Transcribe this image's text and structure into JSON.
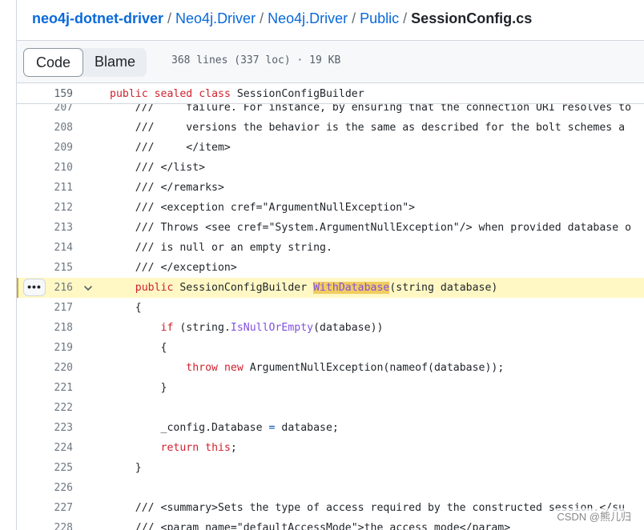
{
  "breadcrumb": {
    "repo": "neo4j-dotnet-driver",
    "sep": "/",
    "parts": [
      "Neo4j.Driver",
      "Neo4j.Driver",
      "Public"
    ],
    "file": "SessionConfig.cs"
  },
  "toolbar": {
    "code_label": "Code",
    "blame_label": "Blame",
    "file_info": "368 lines (337 loc) · 19 KB"
  },
  "sticky": {
    "line": "159",
    "tokens": [
      "public",
      "sealed",
      "class",
      "SessionConfigBuilder"
    ]
  },
  "lines": [
    {
      "n": "207",
      "text": "    ///     failure. For instance, by ensuring that the connection URI resolves to"
    },
    {
      "n": "208",
      "text": "    ///     versions the behavior is the same as described for the bolt schemes a"
    },
    {
      "n": "209",
      "text": "    ///     </item>"
    },
    {
      "n": "210",
      "text": "    /// </list>"
    },
    {
      "n": "211",
      "text": "    /// </remarks>"
    },
    {
      "n": "212",
      "text": "    /// <exception cref=\"ArgumentNullException\">"
    },
    {
      "n": "213",
      "text": "    /// Throws <see cref=\"System.ArgumentNullException\"/> when provided database o"
    },
    {
      "n": "214",
      "text": "    /// is null or an empty string."
    },
    {
      "n": "215",
      "text": "    /// </exception>"
    },
    {
      "n": "216",
      "parts": [
        "    ",
        "public",
        " SessionConfigBuilder ",
        "WithDatabase",
        "(string database)"
      ]
    },
    {
      "n": "217",
      "text": "    {"
    },
    {
      "n": "218",
      "parts": [
        "        ",
        "if",
        " (string.",
        "IsNullOrEmpty",
        "(database))"
      ]
    },
    {
      "n": "219",
      "text": "        {"
    },
    {
      "n": "220",
      "parts": [
        "            ",
        "throw",
        " ",
        "new",
        " ArgumentNullException(nameof(database));"
      ]
    },
    {
      "n": "221",
      "text": "        }"
    },
    {
      "n": "222",
      "text": ""
    },
    {
      "n": "223",
      "parts": [
        "        _config.Database ",
        "=",
        " database;"
      ]
    },
    {
      "n": "224",
      "parts": [
        "        ",
        "return",
        " ",
        "this",
        ";"
      ]
    },
    {
      "n": "225",
      "text": "    }"
    },
    {
      "n": "226",
      "text": ""
    },
    {
      "n": "227",
      "text": "    /// <summary>Sets the type of access required by the constructed session.</su"
    },
    {
      "n": "228",
      "text": "    /// <param name=\"defaultAccessMode\">the access mode</param>"
    }
  ],
  "gutter": {
    "more_label": "•••"
  },
  "watermark": "CSDN @熊儿归",
  "colors": {
    "keyword": "#cf222e",
    "method": "#8250df",
    "operator": "#0550ae",
    "highlight": "#fff8c5",
    "match": "#f2cc60"
  },
  "icons": [
    "chevron-down-icon",
    "kebab-horizontal-icon"
  ]
}
